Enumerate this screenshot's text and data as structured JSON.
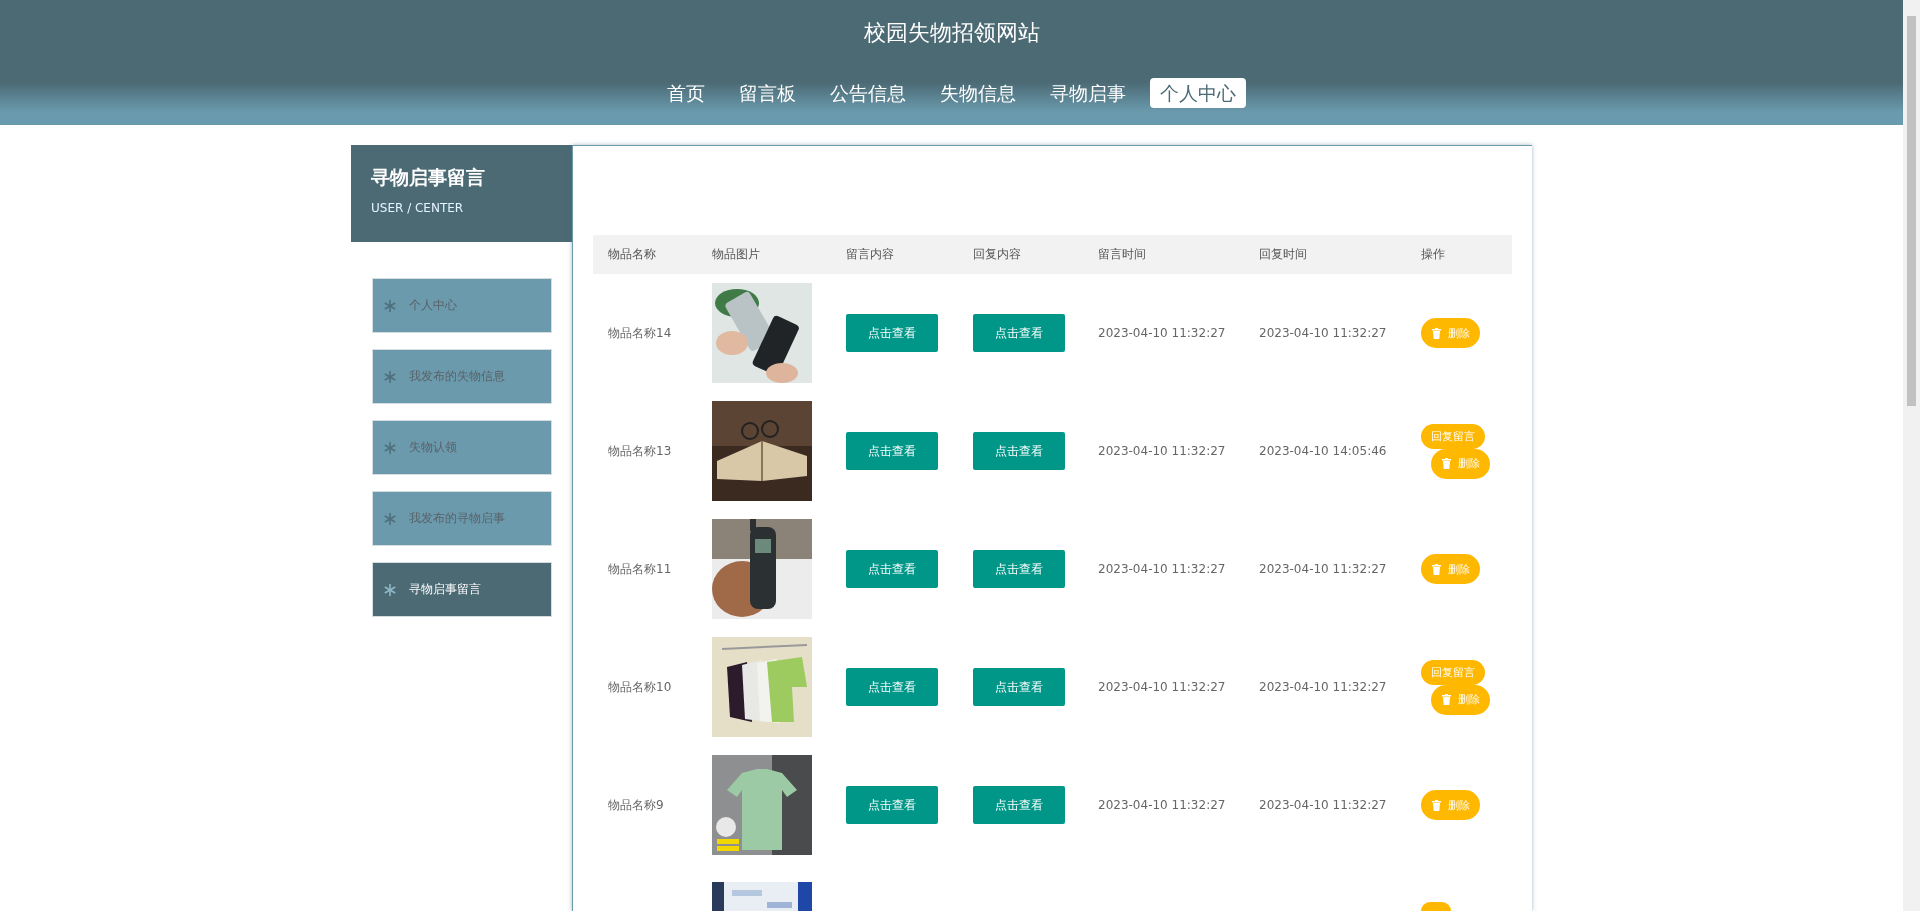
{
  "site_title": "校园失物招领网站",
  "nav": [
    {
      "label": "首页",
      "selected": false
    },
    {
      "label": "留言板",
      "selected": false
    },
    {
      "label": "公告信息",
      "selected": false
    },
    {
      "label": "失物信息",
      "selected": false
    },
    {
      "label": "寻物启事",
      "selected": false
    },
    {
      "label": "个人中心",
      "selected": true
    }
  ],
  "sidebar": {
    "title": "寻物启事留言",
    "subtitle": "USER / CENTER",
    "items": [
      {
        "label": "个人中心",
        "selected": false
      },
      {
        "label": "我发布的失物信息",
        "selected": false
      },
      {
        "label": "失物认领",
        "selected": false
      },
      {
        "label": "我发布的寻物启事",
        "selected": false
      },
      {
        "label": "寻物启事留言",
        "selected": true
      }
    ]
  },
  "table": {
    "columns": [
      "物品名称",
      "物品图片",
      "留言内容",
      "回复内容",
      "留言时间",
      "回复时间",
      "操作"
    ],
    "rows": [
      {
        "name": "物品名称14",
        "message": "点击查看",
        "reply": "点击查看",
        "message_time": "2023-04-10 11:32:27",
        "reply_time": "2023-04-10 11:32:27",
        "actions": [
          {
            "kind": "delete",
            "label": "删除"
          }
        ]
      },
      {
        "name": "物品名称13",
        "message": "点击查看",
        "reply": "点击查看",
        "message_time": "2023-04-10 11:32:27",
        "reply_time": "2023-04-10 14:05:46",
        "actions": [
          {
            "kind": "reply",
            "label": "回复留言"
          },
          {
            "kind": "delete",
            "label": "删除"
          }
        ]
      },
      {
        "name": "物品名称11",
        "message": "点击查看",
        "reply": "点击查看",
        "message_time": "2023-04-10 11:32:27",
        "reply_time": "2023-04-10 11:32:27",
        "actions": [
          {
            "kind": "delete",
            "label": "删除"
          }
        ]
      },
      {
        "name": "物品名称10",
        "message": "点击查看",
        "reply": "点击查看",
        "message_time": "2023-04-10 11:32:27",
        "reply_time": "2023-04-10 11:32:27",
        "actions": [
          {
            "kind": "reply",
            "label": "回复留言"
          },
          {
            "kind": "delete",
            "label": "删除"
          }
        ]
      },
      {
        "name": "物品名称9",
        "message": "点击查看",
        "reply": "点击查看",
        "message_time": "2023-04-10 11:32:27",
        "reply_time": "2023-04-10 11:32:27",
        "actions": [
          {
            "kind": "delete",
            "label": "删除"
          }
        ]
      },
      {
        "partial": true
      }
    ]
  }
}
